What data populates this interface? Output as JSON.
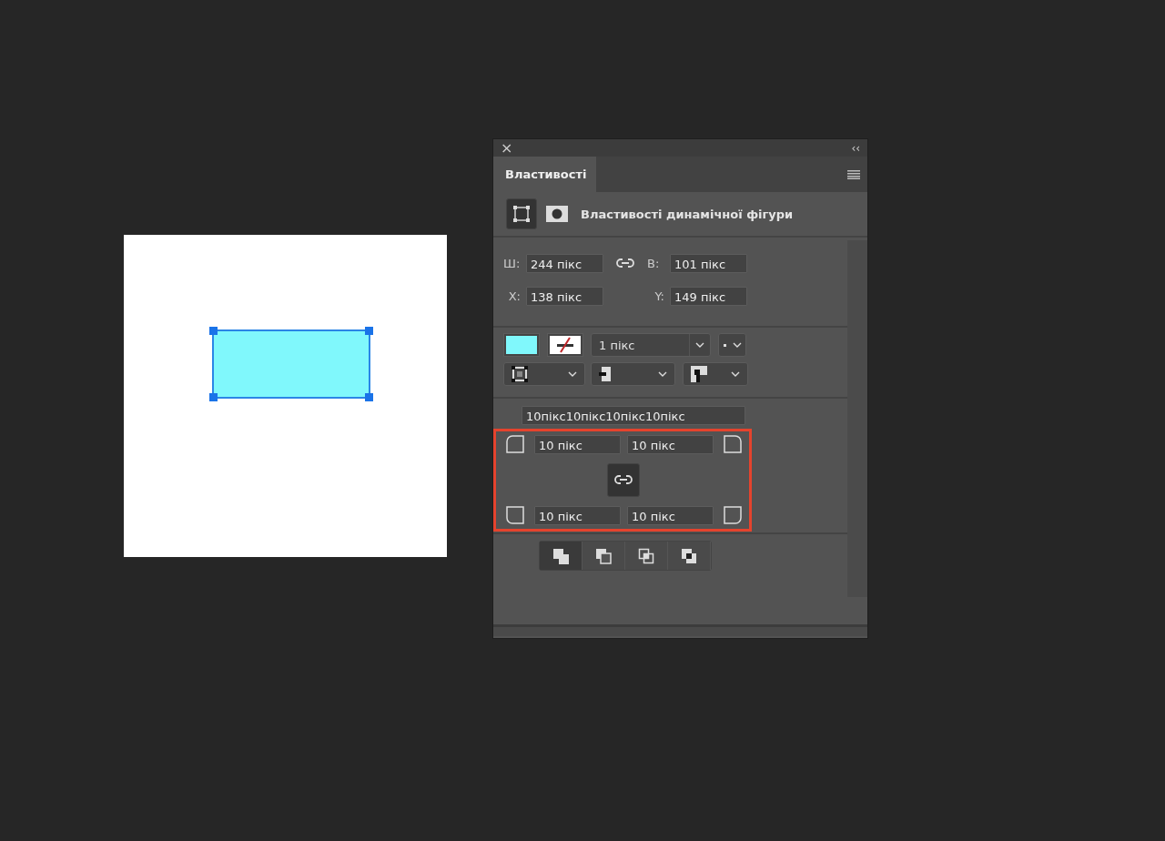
{
  "panel": {
    "close": "×",
    "collapse": "‹‹",
    "tabs": [
      {
        "label": "Властивості",
        "selected": true
      }
    ],
    "modes": [
      {
        "kind": "shape",
        "selected": true
      },
      {
        "kind": "mask",
        "selected": false
      }
    ],
    "heading": "Властивості динамічної фігури",
    "transform": {
      "width_label": "Ш:",
      "width": "244 пікс",
      "linked": false,
      "height_label": "В:",
      "height": "101 пікс",
      "x_label": "X:",
      "x": "138 пікс",
      "y_label": "Y:",
      "y": "149 пікс"
    },
    "appearance": {
      "stroke_width": "1 пікс"
    },
    "corners": {
      "summary": "10пікс10пікс10пікс10пікс",
      "values": [
        "10 пікс",
        "10 пікс",
        "10 пікс",
        "10 пікс"
      ],
      "linked": true,
      "highlighted": true
    },
    "path_ops": [
      {
        "kind": "combine",
        "selected": true
      },
      {
        "kind": "subtract",
        "selected": false
      },
      {
        "kind": "intersect",
        "selected": false
      },
      {
        "kind": "exclude",
        "selected": false
      }
    ]
  }
}
